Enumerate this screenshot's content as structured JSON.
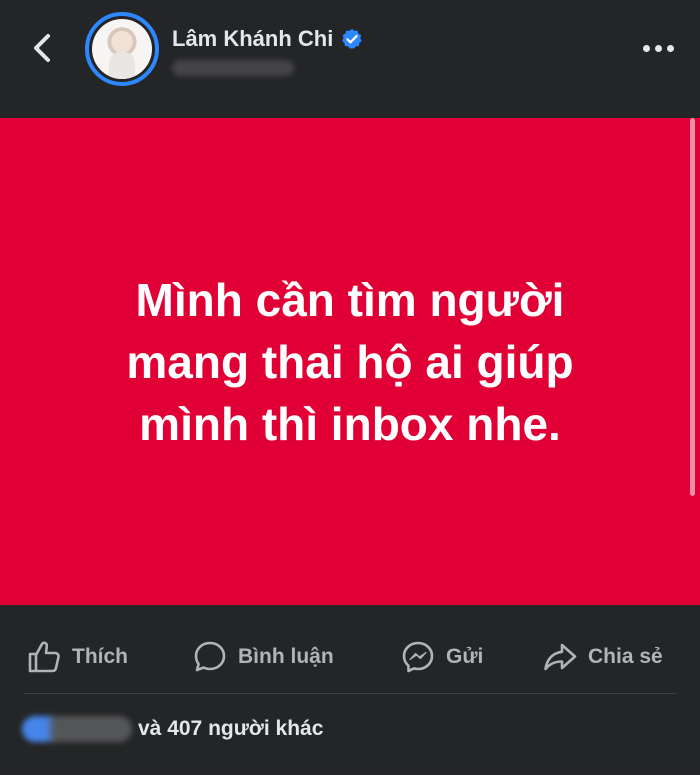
{
  "header": {
    "author_name": "Lâm Khánh Chi",
    "verified": true
  },
  "post": {
    "background_color": "#e10035",
    "text_lines": [
      "Mình cần tìm người",
      "mang thai hộ ai giúp",
      "mình thì inbox nhe."
    ]
  },
  "actions": {
    "like_label": "Thích",
    "comment_label": "Bình luận",
    "send_label": "Gửi",
    "share_label": "Chia sẻ"
  },
  "reactions": {
    "others_text": "và 407 người khác"
  },
  "icons": [
    "back-icon",
    "verified-badge-icon",
    "more-options-icon",
    "like-icon",
    "comment-icon",
    "messenger-icon",
    "share-icon"
  ]
}
